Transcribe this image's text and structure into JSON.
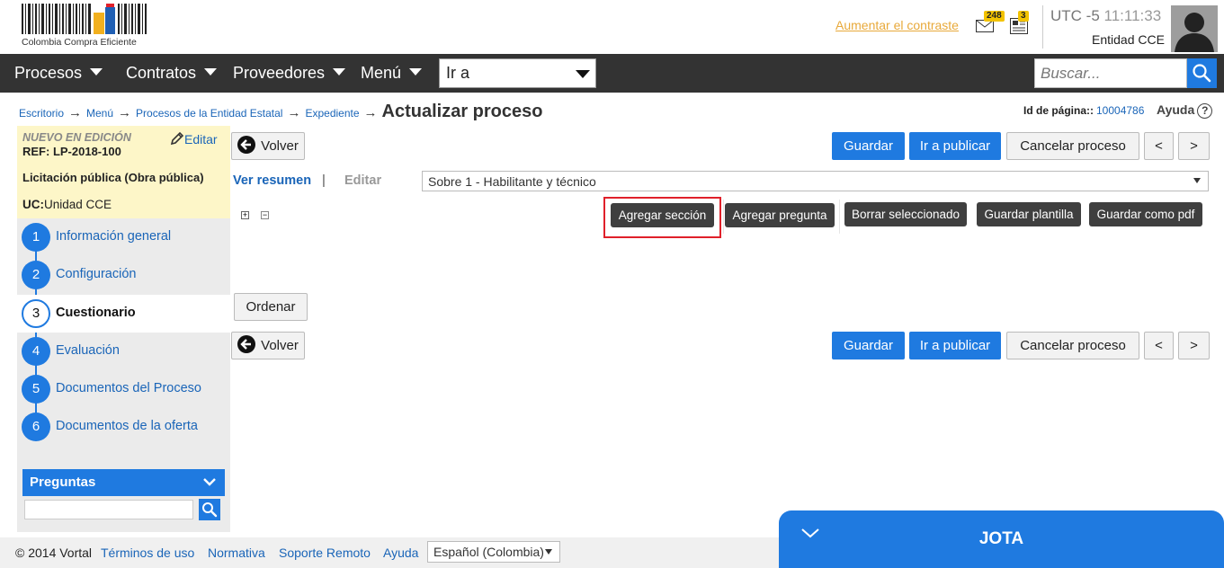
{
  "header": {
    "logo_text": "Colombia Compra Eficiente",
    "contrast_link": "Aumentar el contraste",
    "mail_count": "248",
    "news_count": "3",
    "utc": "UTC -5",
    "time": "11:11:33",
    "entity": "Entidad CCE"
  },
  "nav": {
    "items": [
      "Procesos",
      "Contratos",
      "Proveedores",
      "Menú"
    ],
    "goto_value": "Ir a",
    "search_placeholder": "Buscar..."
  },
  "breadcrumb": {
    "items": [
      "Escritorio",
      "Menú",
      "Procesos de la Entidad Estatal",
      "Expediente"
    ],
    "current": "Actualizar proceso",
    "page_id_label": "Id de página::",
    "page_id": "10004786",
    "help": "Ayuda",
    "help_icon": "?"
  },
  "process": {
    "status": "NUEVO EN EDICIÓN",
    "edit": "Editar",
    "ref": "REF: LP-2018-100",
    "type": "Licitación pública (Obra pública)",
    "uc_label": "UC:",
    "uc_value": "Unidad CCE"
  },
  "steps": [
    {
      "num": "1",
      "label": "Información general"
    },
    {
      "num": "2",
      "label": "Configuración"
    },
    {
      "num": "3",
      "label": "Cuestionario"
    },
    {
      "num": "4",
      "label": "Evaluación"
    },
    {
      "num": "5",
      "label": "Documentos del Proceso"
    },
    {
      "num": "6",
      "label": "Documentos de la oferta"
    }
  ],
  "questions": {
    "title": "Preguntas"
  },
  "actions": {
    "back": "Volver",
    "save": "Guardar",
    "publish": "Ir a publicar",
    "cancel": "Cancelar proceso",
    "prev": "<",
    "next": ">",
    "sort": "Ordenar"
  },
  "tabs": {
    "summary": "Ver resumen",
    "separator": "|",
    "edit": "Editar"
  },
  "envelope": "Sobre 1 - Habilitante y técnico",
  "tree": {
    "expand": "+",
    "collapse": "−"
  },
  "toolbar": {
    "add_section": "Agregar sección",
    "add_question": "Agregar pregunta",
    "delete_selected": "Borrar seleccionado",
    "save_template": "Guardar plantilla",
    "save_pdf": "Guardar como pdf"
  },
  "footer": {
    "copyright": "© 2014 Vortal",
    "links": [
      "Términos de uso",
      "Normativa",
      "Soporte Remoto",
      "Ayuda"
    ],
    "language": "Español (Colombia)"
  },
  "chat": {
    "title": "JOTA"
  },
  "colors": {
    "primary": "#1f7ae0",
    "nav_bg": "#333333",
    "highlight": "#e0202a",
    "info_bg": "#fdf6c8"
  }
}
